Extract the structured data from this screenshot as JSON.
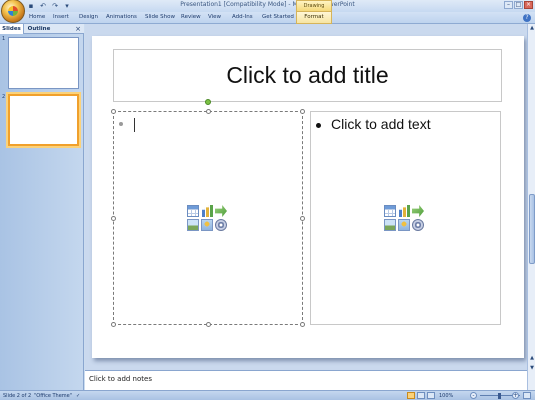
{
  "window": {
    "title": "Presentation1 [Compatibility Mode] - Microsoft PowerPoint",
    "contextual_tab_group": "Drawing Tools"
  },
  "ribbon": {
    "tabs": [
      "Home",
      "Insert",
      "Design",
      "Animations",
      "Slide Show",
      "Review",
      "View",
      "Add-Ins",
      "Get Started",
      "Format"
    ]
  },
  "left_pane": {
    "tabs": [
      "Slides",
      "Outline"
    ],
    "thumbnails": [
      {
        "number": "1"
      },
      {
        "number": "2"
      }
    ]
  },
  "slide": {
    "title_placeholder": "Click to add title",
    "right_placeholder": "Click to add text",
    "content_icons": [
      "table-icon",
      "chart-icon",
      "smartart-icon",
      "picture-icon",
      "clipart-icon",
      "media-icon"
    ]
  },
  "notes": {
    "placeholder": "Click to add notes"
  },
  "status_bar": {
    "slide_info": "Slide 2 of 2",
    "theme": "\"Office Theme\"",
    "zoom": "100%"
  },
  "colors": {
    "accent": "#f0a02c",
    "ribbon": "#c6d9f1",
    "contextual": "#f5d97a"
  }
}
